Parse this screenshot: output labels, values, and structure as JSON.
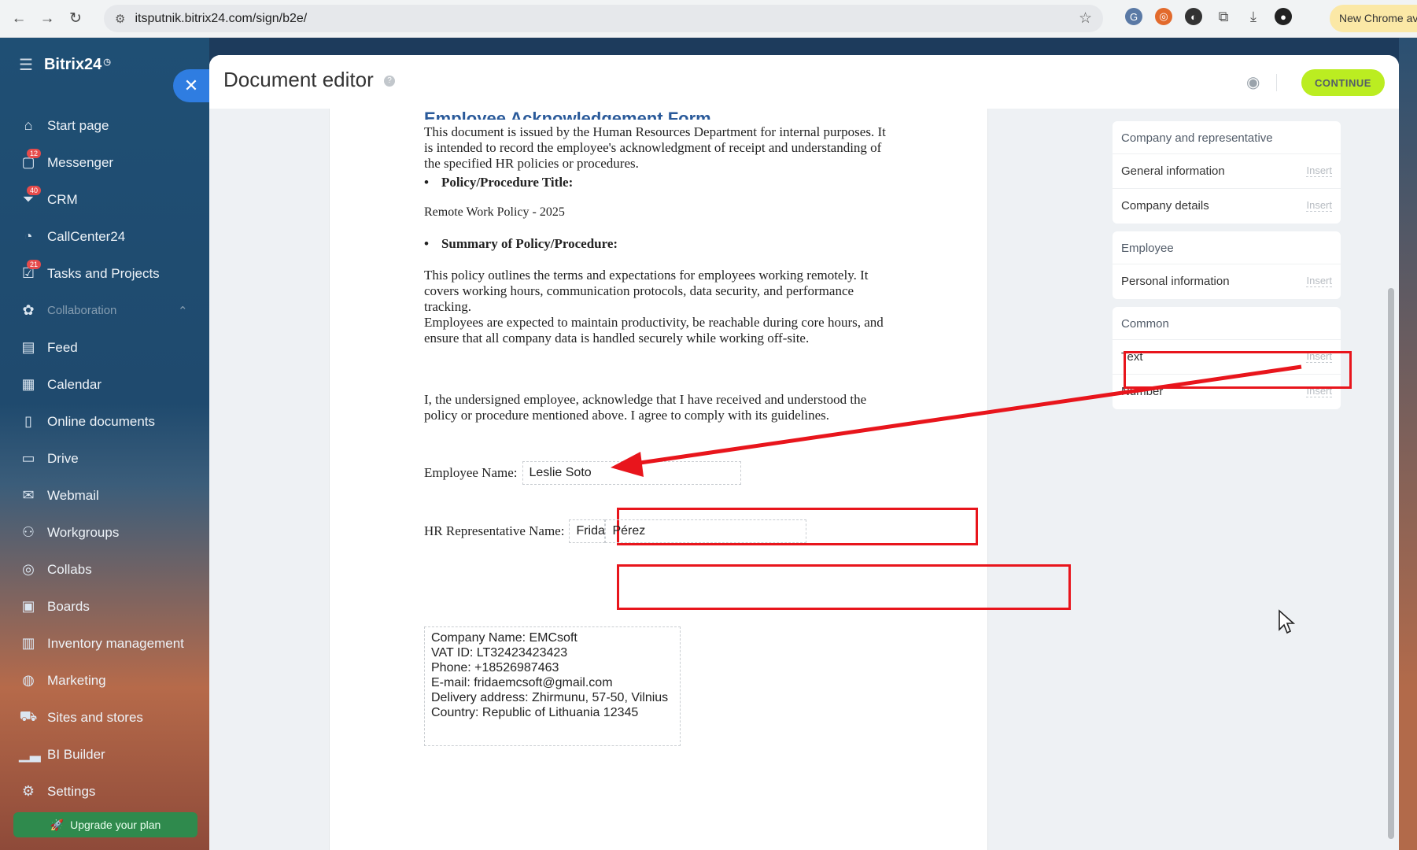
{
  "browser": {
    "url": "itsputnik.bitrix24.com/sign/b2e/",
    "new_chrome": "New Chrome ava"
  },
  "sidebar": {
    "brand": "Bitrix24",
    "items": [
      {
        "label": "Start page",
        "icon": "home-icon"
      },
      {
        "label": "Messenger",
        "icon": "chat-icon",
        "badge": "12"
      },
      {
        "label": "CRM",
        "icon": "funnel-icon",
        "badge": "40"
      },
      {
        "label": "CallCenter24",
        "icon": "phone-icon"
      },
      {
        "label": "Tasks and Projects",
        "icon": "checkbox-icon",
        "badge": "21"
      },
      {
        "label": "Collaboration",
        "icon": "collab-icon"
      },
      {
        "label": "Feed",
        "icon": "feed-icon"
      },
      {
        "label": "Calendar",
        "icon": "calendar-icon"
      },
      {
        "label": "Online documents",
        "icon": "document-icon"
      },
      {
        "label": "Drive",
        "icon": "drive-icon"
      },
      {
        "label": "Webmail",
        "icon": "mail-icon"
      },
      {
        "label": "Workgroups",
        "icon": "group-icon"
      },
      {
        "label": "Collabs",
        "icon": "collabs-icon"
      },
      {
        "label": "Boards",
        "icon": "board-icon"
      },
      {
        "label": "Inventory management",
        "icon": "inventory-icon"
      },
      {
        "label": "Marketing",
        "icon": "marketing-icon"
      },
      {
        "label": "Sites and stores",
        "icon": "cart-icon"
      },
      {
        "label": "BI Builder",
        "icon": "chart-icon"
      },
      {
        "label": "Settings",
        "icon": "gear-icon"
      }
    ],
    "upgrade": "Upgrade your plan"
  },
  "header": {
    "title": "Document editor",
    "continue": "CONTINUE"
  },
  "document": {
    "heading": "Employee Acknowledgement Form",
    "intro": "This document is issued by the Human Resources Department for internal purposes. It is intended to record the employee's acknowledgment of receipt and understanding of the specified HR policies or procedures.",
    "bullet1": "Policy/Procedure Title:",
    "policy_title": "Remote Work Policy - 2025",
    "bullet2": "Summary of Policy/Procedure:",
    "summary1": "This policy outlines the terms and expectations for employees working remotely. It covers working hours, communication protocols, data security, and performance tracking.",
    "summary2": "Employees are expected to maintain productivity, be reachable during core hours, and ensure that all company data is handled securely while working off-site.",
    "acknowledge": "I, the undersigned employee, acknowledge that I have received and understood the policy or procedure mentioned above. I agree to comply with its guidelines.",
    "employee_label": "Employee Name:",
    "employee_value": "Leslie Soto",
    "hr_label": "HR Representative Name:",
    "hr_value_first": "Frida",
    "hr_value_last": "Pérez",
    "company_lines": [
      "Company Name: EMCsoft",
      "VAT ID: LT32423423423",
      "Phone: +18526987463",
      "E-mail: fridaemcsoft@gmail.com",
      "Delivery address: Zhirmunu, 57-50, Vilnius",
      "Country: Republic of Lithuania 12345"
    ]
  },
  "fields_panel": {
    "insert": "Insert",
    "groups": [
      {
        "title": "Company and representative",
        "rows": [
          "General information",
          "Company details"
        ]
      },
      {
        "title": "Employee",
        "rows": [
          "Personal information"
        ]
      },
      {
        "title": "Common",
        "rows": [
          "Text",
          "Number"
        ]
      }
    ]
  },
  "colors": {
    "accent_blue": "#2f7de1",
    "continue_green": "#bbed21",
    "highlight_red": "#e8151c"
  }
}
